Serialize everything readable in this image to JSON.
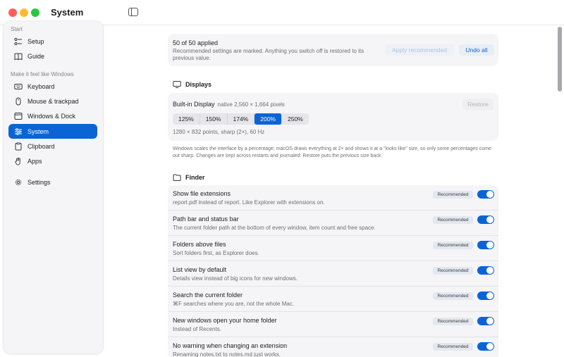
{
  "window": {
    "title": "System"
  },
  "sidebar": {
    "sections": [
      {
        "label": "Start",
        "items": [
          {
            "label": "Setup",
            "icon": "setup-icon"
          },
          {
            "label": "Guide",
            "icon": "book-icon"
          }
        ]
      },
      {
        "label": "Make it feel like Windows",
        "items": [
          {
            "label": "Keyboard",
            "icon": "keyboard-icon"
          },
          {
            "label": "Mouse & trackpad",
            "icon": "mouse-icon"
          },
          {
            "label": "Windows & Dock",
            "icon": "window-icon"
          },
          {
            "label": "System",
            "icon": "sliders-icon",
            "active": true
          },
          {
            "label": "Clipboard",
            "icon": "clipboard-icon"
          },
          {
            "label": "Apps",
            "icon": "hand-icon"
          }
        ]
      }
    ],
    "settings_label": "Settings"
  },
  "applied": {
    "title": "50 of 50 applied",
    "description": "Recommended settings are marked. Anything you switch off is restored to its previous value.",
    "apply_label": "Apply recommended",
    "undo_label": "Undo all"
  },
  "displays": {
    "heading": "Displays",
    "display_name": "Built-in Display",
    "native": "native 2,560 × 1,664 pixels",
    "restore_label": "Restore",
    "scales": [
      "125%",
      "150%",
      "174%",
      "200%",
      "250%"
    ],
    "selected_scale": "200%",
    "info": "1280 × 832 points, sharp (2×), 60 Hz",
    "note": "Windows scales the interface by a percentage; macOS draws everything at 2× and shows it at a \"looks like\" size, so only some percentages come out sharp. Changes are kept across restarts and journaled: Restore puts the previous size back."
  },
  "finder": {
    "heading": "Finder",
    "badge_label": "Recommended",
    "rows": [
      {
        "title": "Show file extensions",
        "desc": "report.pdf instead of report. Like Explorer with extensions on.",
        "on": true
      },
      {
        "title": "Path bar and status bar",
        "desc": "The current folder path at the bottom of every window, item count and free space.",
        "on": true
      },
      {
        "title": "Folders above files",
        "desc": "Sort folders first, as Explorer does.",
        "on": true
      },
      {
        "title": "List view by default",
        "desc": "Details view instead of big icons for new windows.",
        "on": true
      },
      {
        "title": "Search the current folder",
        "desc": "⌘F searches where you are, not the whole Mac.",
        "on": true
      },
      {
        "title": "New windows open your home folder",
        "desc": "Instead of Recents.",
        "on": true
      },
      {
        "title": "No warning when changing an extension",
        "desc": "Renaming notes.txt to notes.md just works.",
        "on": true
      }
    ]
  },
  "colors": {
    "accent": "#0a64d6",
    "sidebar_bg": "#f5f5f7",
    "card_bg": "#f5f5f7"
  }
}
